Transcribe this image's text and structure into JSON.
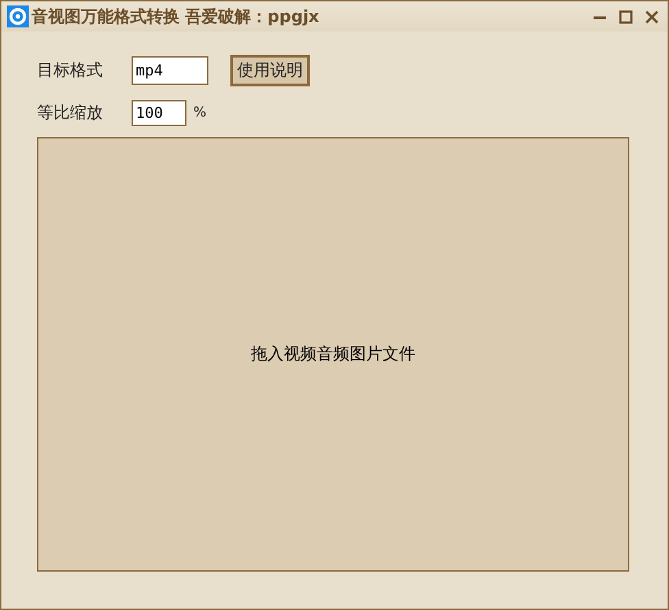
{
  "window": {
    "title": "音视图万能格式转换 吾爱破解：ppgjx"
  },
  "format": {
    "label": "目标格式",
    "value": "mp4"
  },
  "help_button": {
    "label": "使用说明"
  },
  "scale": {
    "label": "等比缩放",
    "value": "100",
    "unit": "%"
  },
  "drop_area": {
    "text": "拖入视频音频图片文件"
  }
}
